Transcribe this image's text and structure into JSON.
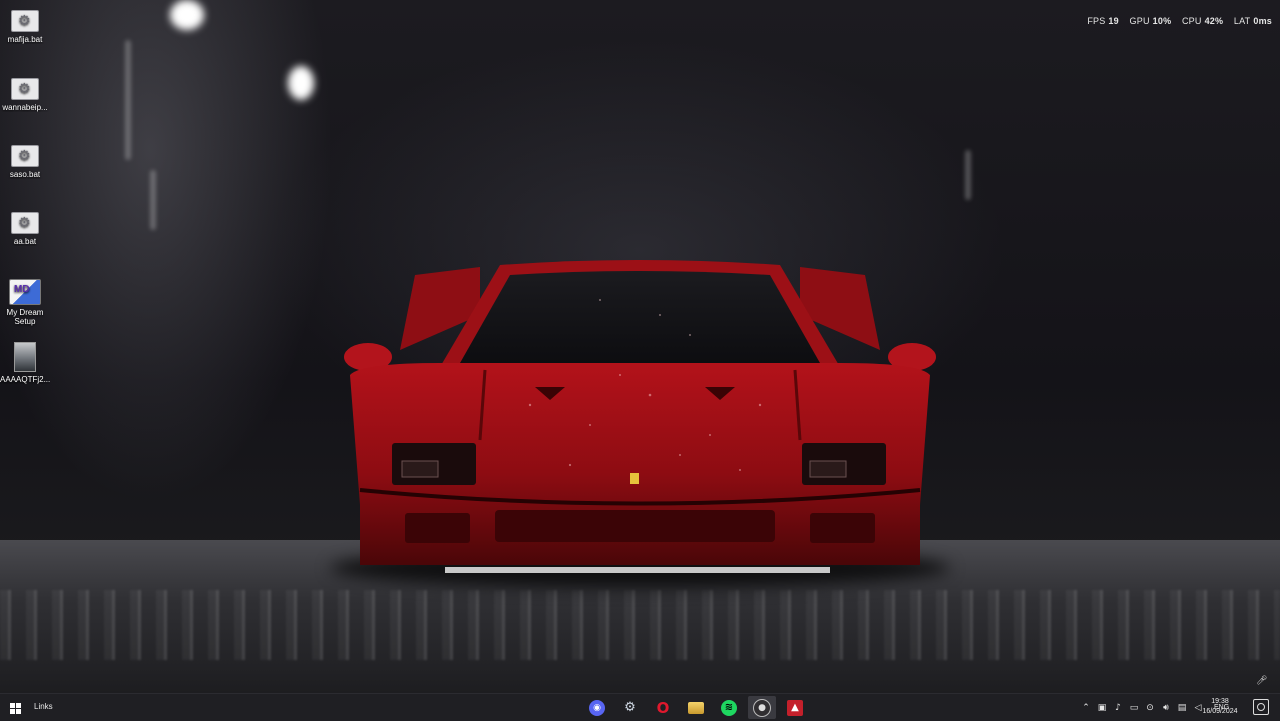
{
  "desktop": {
    "icons": [
      {
        "label": "mafija.bat"
      },
      {
        "label": "wannabeip..."
      },
      {
        "label": "saso.bat"
      },
      {
        "label": "aa.bat"
      },
      {
        "label": "My Dream Setup"
      },
      {
        "label": "AAAAQTFj2..."
      }
    ]
  },
  "overlay": {
    "fps_label": "FPS",
    "fps_value": "19",
    "gpu_label": "GPU",
    "gpu_value": "10%",
    "cpu_label": "CPU",
    "cpu_value": "42%",
    "lat_label": "LAT",
    "lat_value": "0ms"
  },
  "taskbar": {
    "toolbar_label": "Links",
    "apps": [
      {
        "name": "discord-icon",
        "color": "#5865f2"
      },
      {
        "name": "steam-icon",
        "color": "#1b2838"
      },
      {
        "name": "opera-icon",
        "color": "#e0182d"
      },
      {
        "name": "file-explorer-icon",
        "color": "#d9b44a"
      },
      {
        "name": "spotify-icon",
        "color": "#1ed760"
      },
      {
        "name": "obs-icon",
        "color": "#302e31"
      },
      {
        "name": "app-red-icon",
        "color": "#c4202b"
      }
    ],
    "language": "ENG",
    "time": "19:38",
    "date": "16/09/2024"
  }
}
